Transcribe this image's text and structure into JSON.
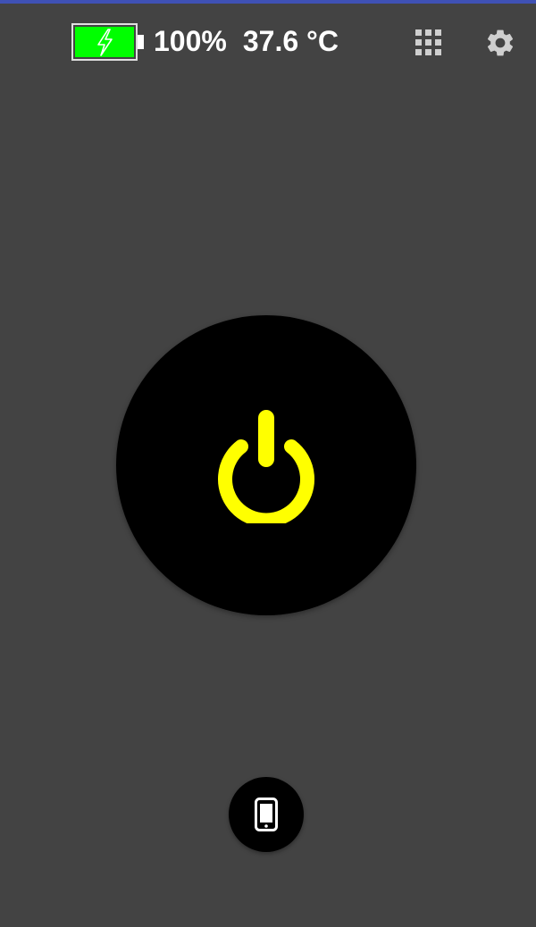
{
  "status": {
    "battery_percent": "100%",
    "temperature": "37.6 °C",
    "battery_level": 1.0,
    "charging": true,
    "battery_fill_color": "#00ff00",
    "battery_icon": "battery-charging-icon"
  },
  "toolbar": {
    "apps_icon": "grid-icon",
    "settings_icon": "gear-icon"
  },
  "main": {
    "power_icon": "power-icon",
    "power_color": "#ffff00",
    "screen_light_icon": "smartphone-icon"
  },
  "colors": {
    "background": "#434343",
    "accent_top": "#3f51b5",
    "icon_gray": "#cfcfcf"
  }
}
